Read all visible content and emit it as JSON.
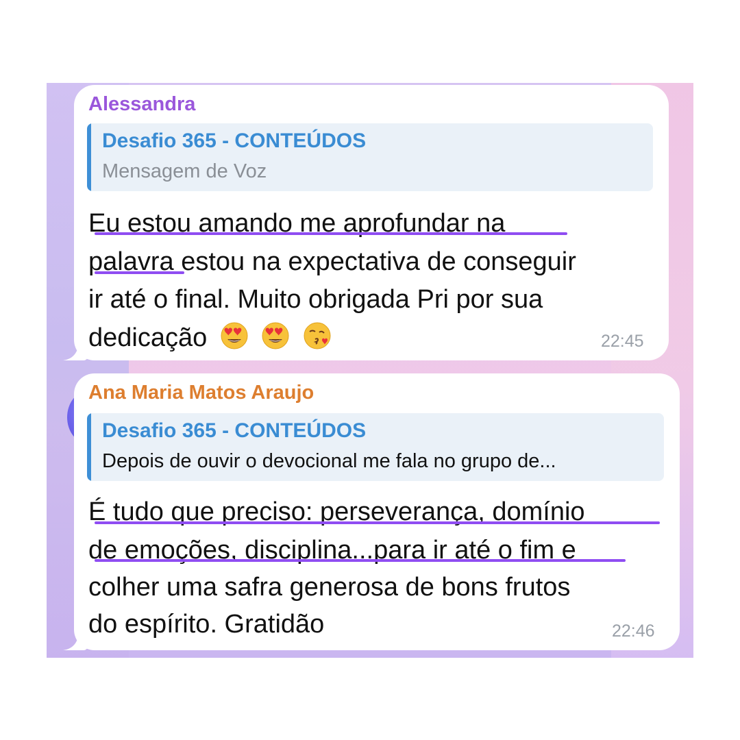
{
  "messages": [
    {
      "sender": "Alessandra",
      "sender_color": "#9a57db",
      "reply": {
        "title": "Desafio 365 - CONTEÚDOS",
        "text": "Mensagem de Voz"
      },
      "lines": [
        "Eu estou amando  me aprofundar na",
        "palavra  estou na expectativa de conseguir",
        "ir até  o final. Muito obrigada Pri por sua",
        "dedicação"
      ],
      "emojis": [
        "heart-eyes-emoji",
        "heart-eyes-emoji",
        "kissing-heart-emoji"
      ],
      "time": "22:45"
    },
    {
      "sender": "Ana Maria Matos Araujo",
      "sender_color": "#dd7e2f",
      "reply": {
        "title": "Desafio 365 - CONTEÚDOS",
        "text": "Depois de ouvir o devocional me fala no grupo de..."
      },
      "lines": [
        "É tudo que preciso: perseverança,  domínio",
        "de emoções,  disciplina...para ir até o fim e",
        "colher uma safra generosa de bons frutos",
        "do espírito. Gratidão"
      ],
      "time": "22:46"
    }
  ],
  "colors": {
    "reply_accent": "#3e8fd6",
    "highlight_underline": "#8f4df2",
    "bubble_background": "#ffffff"
  }
}
